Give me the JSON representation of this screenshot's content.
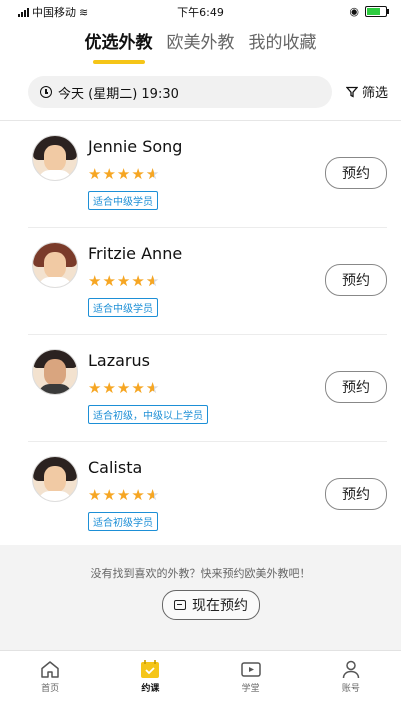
{
  "status_bar": {
    "carrier": "中国移动",
    "time": "下午6:49"
  },
  "tabs": [
    {
      "label": "优选外教",
      "active": true
    },
    {
      "label": "欧美外教",
      "active": false
    },
    {
      "label": "我的收藏",
      "active": false
    }
  ],
  "filter": {
    "date_label": "今天 (星期二) 19:30",
    "filter_label": "筛选"
  },
  "teachers": [
    {
      "name": "Jennie Song",
      "rating": 4.5,
      "tag": "适合中级学员",
      "button": "预约"
    },
    {
      "name": "Fritzie Anne",
      "rating": 4.5,
      "tag": "适合中级学员",
      "button": "预约"
    },
    {
      "name": "Lazarus",
      "rating": 4.5,
      "tag": "适合初级，中级以上学员",
      "button": "预约"
    },
    {
      "name": "Calista",
      "rating": 4.5,
      "tag": "适合初级学员",
      "button": "预约"
    }
  ],
  "promo": {
    "text": "没有找到喜欢的外教？快来预约欧美外教吧！",
    "button": "现在预约"
  },
  "bottom_nav": [
    {
      "label": "首页",
      "icon": "home-icon",
      "active": false
    },
    {
      "label": "约课",
      "icon": "calendar-icon",
      "active": true
    },
    {
      "label": "学堂",
      "icon": "video-icon",
      "active": false
    },
    {
      "label": "账号",
      "icon": "user-icon",
      "active": false
    }
  ],
  "colors": {
    "accent": "#f5c518",
    "star": "#f6a623",
    "tag": "#1d8fd6"
  }
}
